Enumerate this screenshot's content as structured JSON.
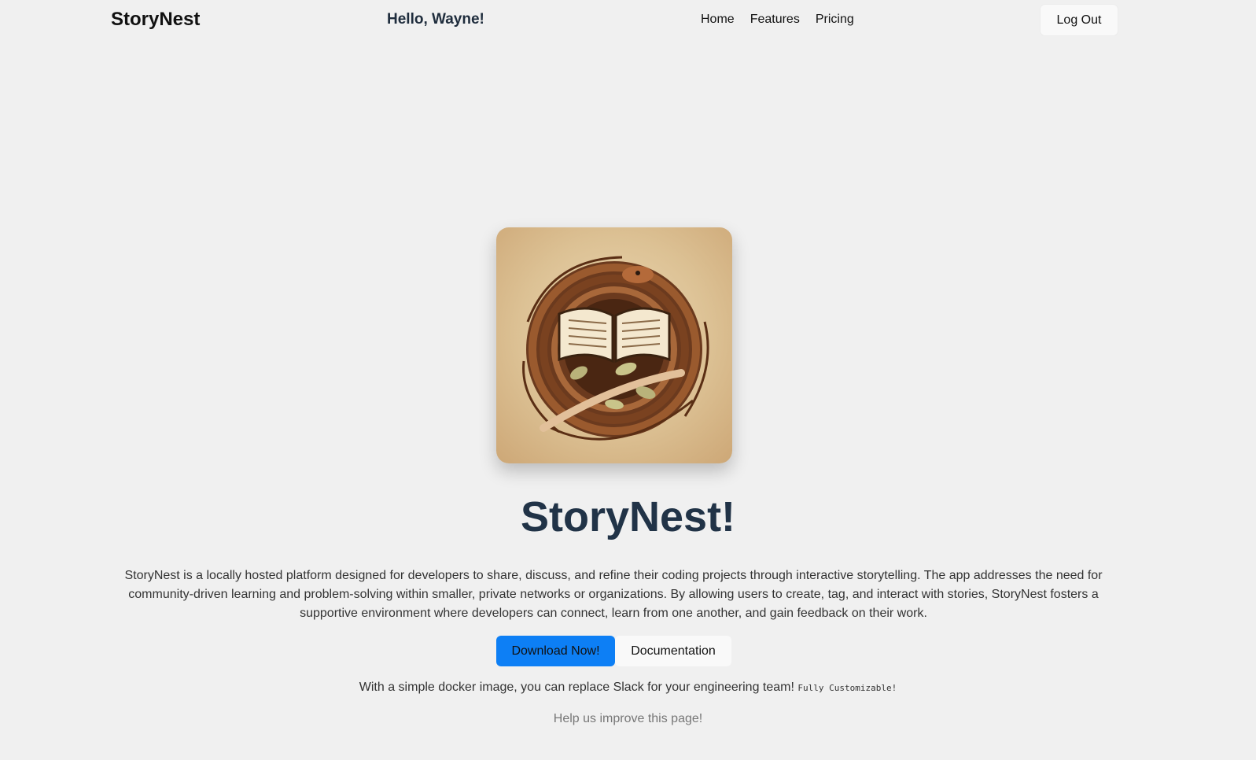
{
  "header": {
    "brand": "StoryNest",
    "greeting": "Hello, Wayne!",
    "nav": [
      {
        "label": "Home"
      },
      {
        "label": "Features"
      },
      {
        "label": "Pricing"
      }
    ],
    "logout_label": "Log Out"
  },
  "hero": {
    "logo_icon": "storynest-logo-nest-book-icon",
    "title": "StoryNest!",
    "description": "StoryNest is a locally hosted platform designed for developers to share, discuss, and refine their coding projects through interactive storytelling. The app addresses the need for community-driven learning and problem-solving within smaller, private networks or organizations. By allowing users to create, tag, and interact with stories, StoryNest fosters a supportive environment where developers can connect, learn from one another, and gain feedback on their work.",
    "primary_button": "Download Now!",
    "secondary_button": "Documentation",
    "tagline": "With a simple docker image, you can replace Slack for your engineering team!",
    "tagline_code": "Fully Customizable!",
    "help_text": "Help us improve this page!"
  },
  "colors": {
    "background": "#f0f0f0",
    "primary": "#0d7ff5",
    "title": "#213347"
  }
}
